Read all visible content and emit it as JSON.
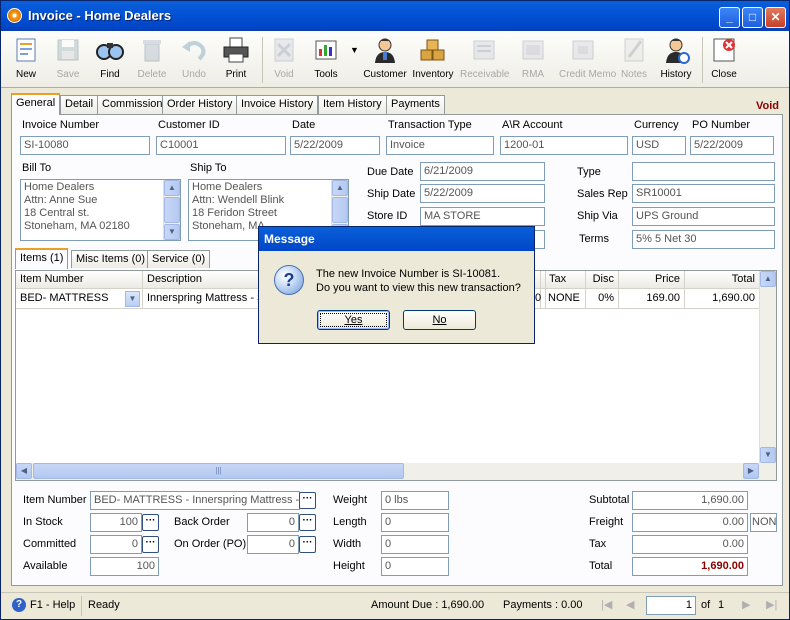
{
  "window": {
    "title": "Invoice - Home Dealers",
    "min": "_",
    "max": "□",
    "close": "✕"
  },
  "toolbar": [
    {
      "label": "New",
      "icon": "new-icon",
      "enabled": true
    },
    {
      "label": "Save",
      "icon": "save-icon",
      "enabled": false
    },
    {
      "label": "Find",
      "icon": "find-icon",
      "enabled": true
    },
    {
      "label": "Delete",
      "icon": "delete-icon",
      "enabled": false
    },
    {
      "label": "Undo",
      "icon": "undo-icon",
      "enabled": false
    },
    {
      "label": "Print",
      "icon": "print-icon",
      "enabled": true
    },
    {
      "label": "Void",
      "icon": "void-icon",
      "enabled": false
    },
    {
      "label": "Tools",
      "icon": "tools-icon",
      "enabled": true
    },
    {
      "label": "Customer",
      "icon": "customer-icon",
      "enabled": true
    },
    {
      "label": "Inventory",
      "icon": "inventory-icon",
      "enabled": true
    },
    {
      "label": "Receivable",
      "icon": "receivable-icon",
      "enabled": false
    },
    {
      "label": "RMA",
      "icon": "rma-icon",
      "enabled": false
    },
    {
      "label": "Credit Memo",
      "icon": "credit-memo-icon",
      "enabled": false
    },
    {
      "label": "Notes",
      "icon": "notes-icon",
      "enabled": false
    },
    {
      "label": "History",
      "icon": "history-icon",
      "enabled": true
    },
    {
      "label": "Close",
      "icon": "close-icon",
      "enabled": true
    }
  ],
  "tabs": [
    "General",
    "Detail",
    "Commission",
    "Order History",
    "Invoice History",
    "Item History",
    "Payments"
  ],
  "status_label": "Void",
  "header": {
    "invoice_number": {
      "label": "Invoice Number",
      "value": "SI-10080"
    },
    "customer_id": {
      "label": "Customer ID",
      "value": "C10001"
    },
    "date": {
      "label": "Date",
      "value": "5/22/2009"
    },
    "transaction_type": {
      "label": "Transaction Type",
      "value": "Invoice"
    },
    "ar_account": {
      "label": "A\\R Account",
      "value": "1200-01"
    },
    "currency": {
      "label": "Currency",
      "value": "USD"
    },
    "po_number": {
      "label": "PO Number",
      "value": "5/22/2009"
    }
  },
  "bill_to": {
    "label": "Bill To",
    "lines": [
      "Home Dealers",
      "Attn: Anne Sue",
      "18 Central st.",
      "Stoneham, MA 02180"
    ]
  },
  "ship_to": {
    "label": "Ship To",
    "lines": [
      "Home Dealers",
      "Attn: Wendell Blink",
      "18 Feridon Street",
      "Stoneham, MA"
    ]
  },
  "mid": {
    "due_date": {
      "label": "Due Date",
      "value": "6/21/2009"
    },
    "ship_date": {
      "label": "Ship Date",
      "value": "5/22/2009"
    },
    "store_id": {
      "label": "Store ID",
      "value": "MA STORE"
    },
    "type": {
      "label": "Type",
      "value": ""
    },
    "sales_rep": {
      "label": "Sales Rep",
      "value": "SR10001"
    },
    "ship_via": {
      "label": "Ship Via",
      "value": "UPS Ground"
    },
    "terms": {
      "label": "Terms",
      "value": "5% 5 Net 30"
    }
  },
  "subtabs": [
    "Items (1)",
    "Misc Items (0)",
    "Service (0)"
  ],
  "grid": {
    "columns": [
      "Item Number",
      "Description",
      "ed",
      "Tax",
      "Disc",
      "Price",
      "Total"
    ],
    "rows": [
      {
        "item_number": "BED- MATTRESS",
        "description": "Innerspring Mattress - S",
        "qty": "0",
        "tax": "NONE",
        "disc": "0%",
        "price": "169.00",
        "total": "1,690.00"
      }
    ]
  },
  "bottom": {
    "item_number": {
      "label": "Item Number",
      "value": "BED- MATTRESS - Innerspring Mattress - S"
    },
    "in_stock": {
      "label": "In Stock",
      "value": "100"
    },
    "committed": {
      "label": "Committed",
      "value": "0"
    },
    "available": {
      "label": "Available",
      "value": "100"
    },
    "back_order": {
      "label": "Back Order",
      "value": "0"
    },
    "on_order": {
      "label": "On Order (PO)",
      "value": "0"
    },
    "weight": {
      "label": "Weight",
      "value": "0 lbs"
    },
    "length": {
      "label": "Length",
      "value": "0"
    },
    "width": {
      "label": "Width",
      "value": "0"
    },
    "height": {
      "label": "Height",
      "value": "0"
    },
    "subtotal": {
      "label": "Subtotal",
      "value": "1,690.00"
    },
    "freight": {
      "label": "Freight",
      "value": "0.00",
      "code": "NON"
    },
    "tax": {
      "label": "Tax",
      "value": "0.00"
    },
    "total": {
      "label": "Total",
      "value": "1,690.00"
    }
  },
  "statusbar": {
    "help": "F1 - Help",
    "state": "Ready",
    "amount_due": "Amount Due : 1,690.00",
    "payments": "Payments : 0.00",
    "page": "1",
    "of": "of",
    "pages": "1"
  },
  "dialog": {
    "title": "Message",
    "line1": "The new Invoice Number is SI-10081.",
    "line2": "Do you want to view this new transaction?",
    "yes": "Yes",
    "no": "No"
  },
  "colors": {
    "title_bar": "#0454d6",
    "accent_tab": "#e8a02a",
    "void_red": "#8b0000"
  }
}
